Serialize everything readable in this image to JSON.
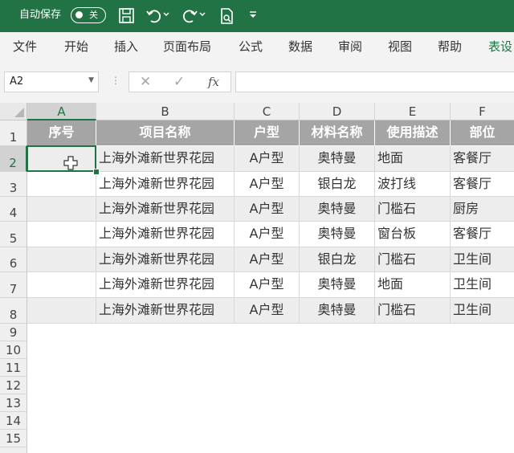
{
  "titlebar": {
    "autosave_label": "自动保存",
    "toggle_state": "关",
    "icons": [
      "save-icon",
      "undo-icon",
      "redo-icon",
      "print-preview-icon",
      "customize-qat-icon"
    ]
  },
  "ribbon": {
    "tabs": [
      "文件",
      "开始",
      "插入",
      "页面布局",
      "公式",
      "数据",
      "审阅",
      "视图",
      "帮助",
      "表设"
    ],
    "active_tab": "表设"
  },
  "formula_bar": {
    "name_box": "A2",
    "cancel_glyph": "✕",
    "enter_glyph": "✓",
    "fx_label": "fx",
    "formula": ""
  },
  "columns": [
    "A",
    "B",
    "C",
    "D",
    "E",
    "F"
  ],
  "selected_column": "A",
  "rows": [
    "1",
    "2",
    "3",
    "4",
    "5",
    "6",
    "7",
    "8",
    "9",
    "10",
    "11",
    "12",
    "13",
    "14",
    "15"
  ],
  "selected_row": "2",
  "table": {
    "headers": [
      "序号",
      "项目名称",
      "户型",
      "材料名称",
      "使用描述",
      "部位"
    ],
    "rows": [
      [
        "",
        "上海外滩新世界花园",
        "A户型",
        "奥特曼",
        "地面",
        "客餐厅"
      ],
      [
        "",
        "上海外滩新世界花园",
        "A户型",
        "银白龙",
        "波打线",
        "客餐厅"
      ],
      [
        "",
        "上海外滩新世界花园",
        "A户型",
        "奥特曼",
        "门槛石",
        "厨房"
      ],
      [
        "",
        "上海外滩新世界花园",
        "A户型",
        "奥特曼",
        "窗台板",
        "客餐厅"
      ],
      [
        "",
        "上海外滩新世界花园",
        "A户型",
        "银白龙",
        "门槛石",
        "卫生间"
      ],
      [
        "",
        "上海外滩新世界花园",
        "A户型",
        "奥特曼",
        "地面",
        "卫生间"
      ],
      [
        "",
        "上海外滩新世界花园",
        "A户型",
        "奥特曼",
        "门槛石",
        "卫生间"
      ]
    ]
  },
  "colors": {
    "accent": "#217346",
    "table_header": "#a5a5a5",
    "band": "#ededed"
  }
}
